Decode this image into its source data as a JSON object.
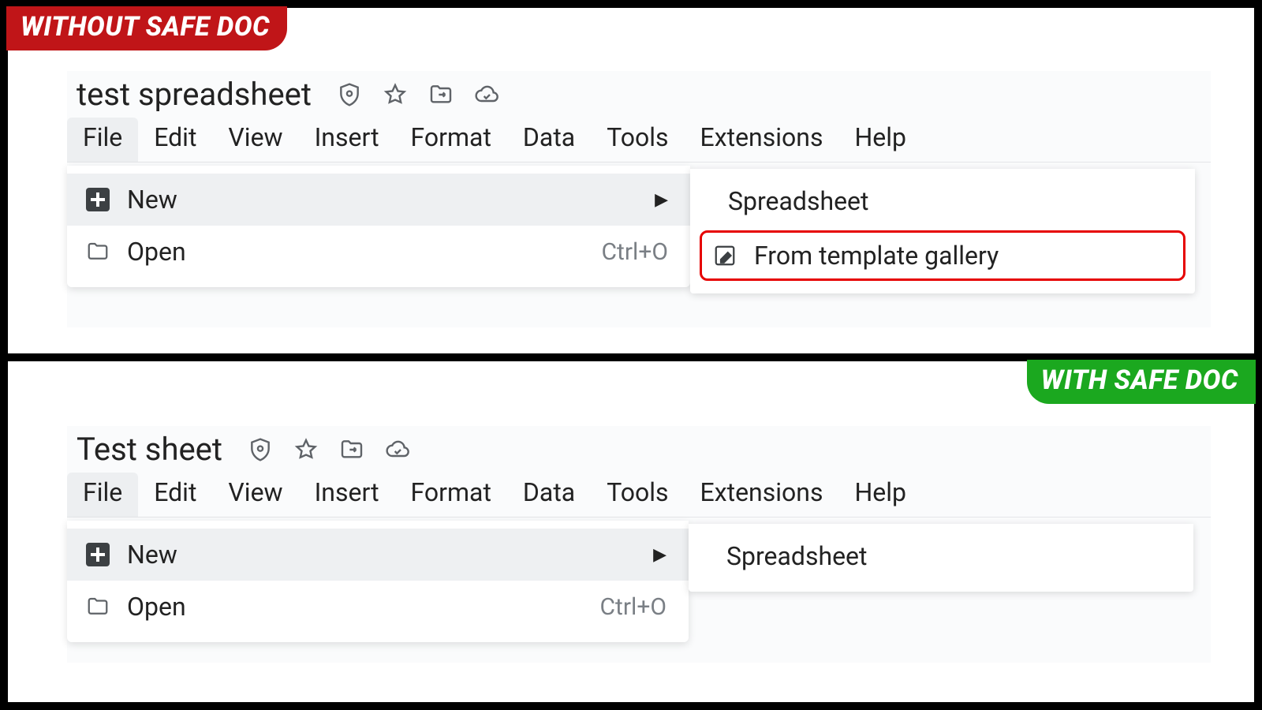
{
  "tags": {
    "without": "WITHOUT SAFE DOC",
    "with": "WITH SAFE DOC"
  },
  "menus": [
    "File",
    "Edit",
    "View",
    "Insert",
    "Format",
    "Data",
    "Tools",
    "Extensions",
    "Help"
  ],
  "file_menu": {
    "new_label": "New",
    "open_label": "Open",
    "open_shortcut": "Ctrl+O"
  },
  "submenu": {
    "spreadsheet": "Spreadsheet",
    "template_gallery": "From template gallery"
  },
  "top": {
    "title": "test spreadsheet"
  },
  "bottom": {
    "title": "Test sheet"
  }
}
